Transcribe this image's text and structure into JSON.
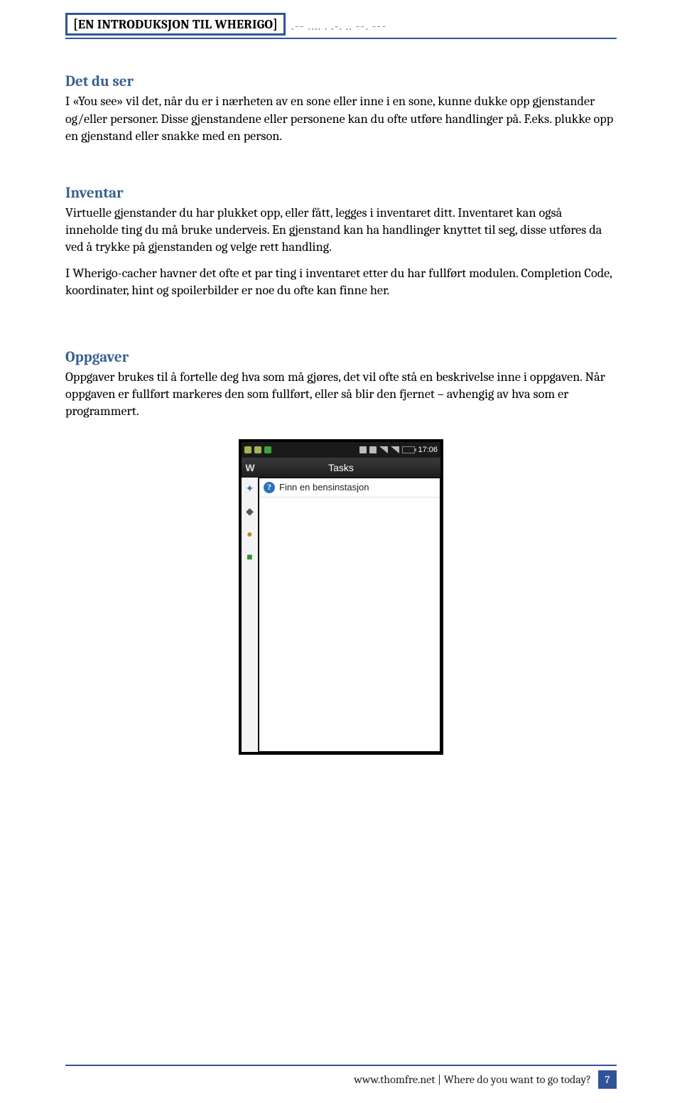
{
  "header": {
    "title": "[EN INTRODUKSJON TIL WHERIGO]",
    "code": ".-- .... . .-. .. --. ---"
  },
  "sections": {
    "det": {
      "heading": "Det du ser",
      "body": "I «You see» vil det, når du er i nærheten av en sone eller inne i en sone, kunne dukke opp gjenstander og/eller personer. Disse gjenstandene eller personene kan du ofte utføre handlinger på. F.eks. plukke opp en gjenstand eller snakke med en person."
    },
    "inventar": {
      "heading": "Inventar",
      "p1": "Virtuelle gjenstander du har plukket opp, eller fått, legges i inventaret ditt. Inventaret kan også inneholde ting du må bruke underveis. En gjenstand kan ha handlinger knyttet til seg, disse utføres da ved å trykke på gjenstanden og velge rett handling.",
      "p2": "I Wherigo-cacher havner det ofte et par ting i inventaret etter du har fullført modulen. Completion Code, koordinater, hint og spoilerbilder er noe du ofte kan finne her."
    },
    "oppgaver": {
      "heading": "Oppgaver",
      "body": "Oppgaver brukes til å fortelle deg hva som må gjøres, det vil ofte stå en beskrivelse inne i oppgaven. Når oppgaven er fullført markeres den som fullført, eller så blir den fjernet – avhengig av hva som er programmert."
    }
  },
  "phone": {
    "statusbar": {
      "time": "17:06"
    },
    "titlebar": {
      "left": "W",
      "title": "Tasks"
    },
    "task": {
      "label": "Finn en bensinstasjon",
      "icon_glyph": "?"
    }
  },
  "footer": {
    "text": "www.thomfre.net | Where do you want to go today?",
    "page": "7"
  }
}
